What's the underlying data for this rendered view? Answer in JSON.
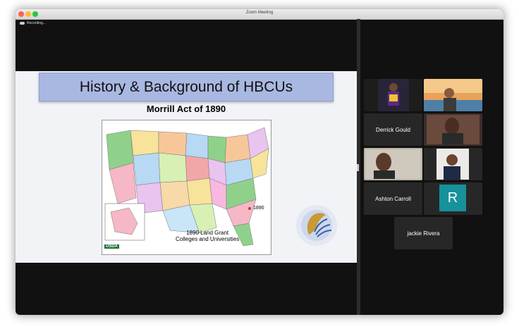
{
  "window": {
    "title": "Zoom Meeting"
  },
  "recording": {
    "label": "Recording..."
  },
  "slide": {
    "banner_title": "History & Background of HBCUs",
    "subtitle": "Morrill Act of 1890",
    "map": {
      "title_line1": "1890 Land Grant",
      "title_line2": "Colleges and Universities",
      "legend_year": "1890",
      "agency": "USDA"
    }
  },
  "participants": [
    {
      "name": "",
      "type": "video"
    },
    {
      "name": "",
      "type": "video"
    },
    {
      "name": "Derrick Gould",
      "type": "name"
    },
    {
      "name": "",
      "type": "video"
    },
    {
      "name": "",
      "type": "video",
      "active_speaker": true
    },
    {
      "name": "",
      "type": "video"
    },
    {
      "name": "Ashton Carroll",
      "type": "name"
    },
    {
      "name": "",
      "type": "avatar",
      "initial": "R"
    },
    {
      "name": "jackie Rivera",
      "type": "name"
    }
  ],
  "colors": {
    "active_speaker_border": "#32c24d",
    "avatar_r": "#17919c",
    "banner": "#a9b8e2"
  }
}
